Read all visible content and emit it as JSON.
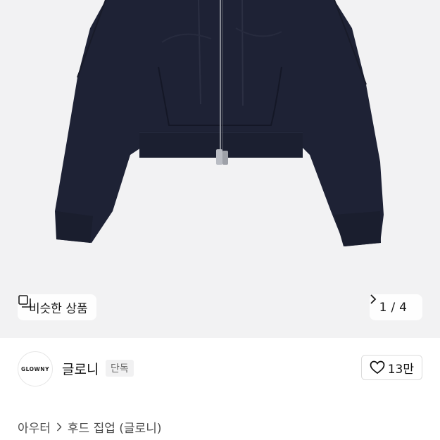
{
  "image_gallery": {
    "similar_products_label": "비슷한 상품",
    "current_index": "1",
    "separator": "/",
    "total": "4"
  },
  "brand": {
    "logo_text": "GLOWNY",
    "name": "글로니",
    "tag": "단독",
    "like_count": "13만"
  },
  "breadcrumb": {
    "items": [
      "아우터",
      "후드 집업 (글로니)"
    ]
  },
  "colors": {
    "jacket": "#1e2235",
    "image_bg": "#f2f2f3"
  },
  "icons": [
    "gallery-icon",
    "chevron-right-icon",
    "heart-icon"
  ]
}
